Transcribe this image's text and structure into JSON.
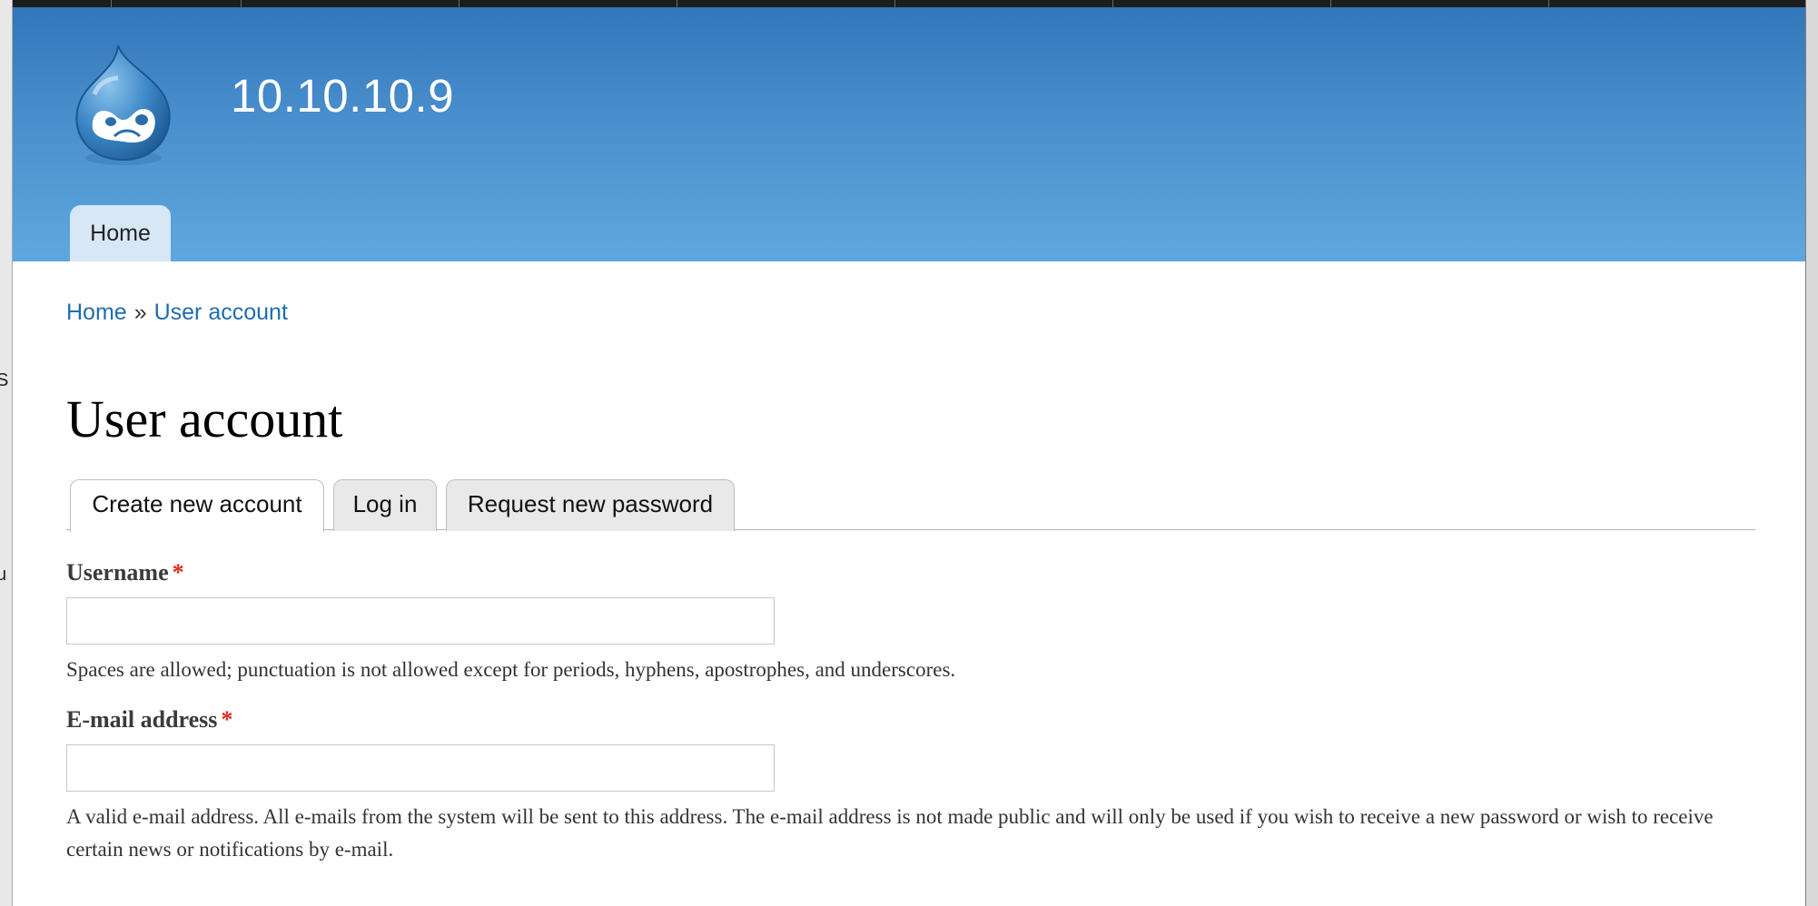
{
  "site": {
    "name": "10.10.10.9"
  },
  "nav": {
    "home_label": "Home"
  },
  "breadcrumb": {
    "home": "Home",
    "separator": "»",
    "current": "User account"
  },
  "page": {
    "title": "User account"
  },
  "tabs": [
    {
      "label": "Create new account",
      "active": true
    },
    {
      "label": "Log in",
      "active": false
    },
    {
      "label": "Request new password",
      "active": false
    }
  ],
  "form": {
    "username": {
      "label": "Username",
      "required_marker": "*",
      "value": "",
      "description": "Spaces are allowed; punctuation is not allowed except for periods, hyphens, apostrophes, and underscores."
    },
    "email": {
      "label": "E-mail address",
      "required_marker": "*",
      "value": "",
      "description": "A valid e-mail address. All e-mails from the system will be sent to this address. The e-mail address is not made public and will only be used if you wish to receive a new password or wish to receive certain news or notifications by e-mail."
    }
  },
  "colors": {
    "header_top": "#3276bb",
    "header_bottom": "#5ea8df",
    "link": "#1f6cb0",
    "required": "#e0261b"
  },
  "icons": {
    "logo": "drupal-drop-logo"
  }
}
